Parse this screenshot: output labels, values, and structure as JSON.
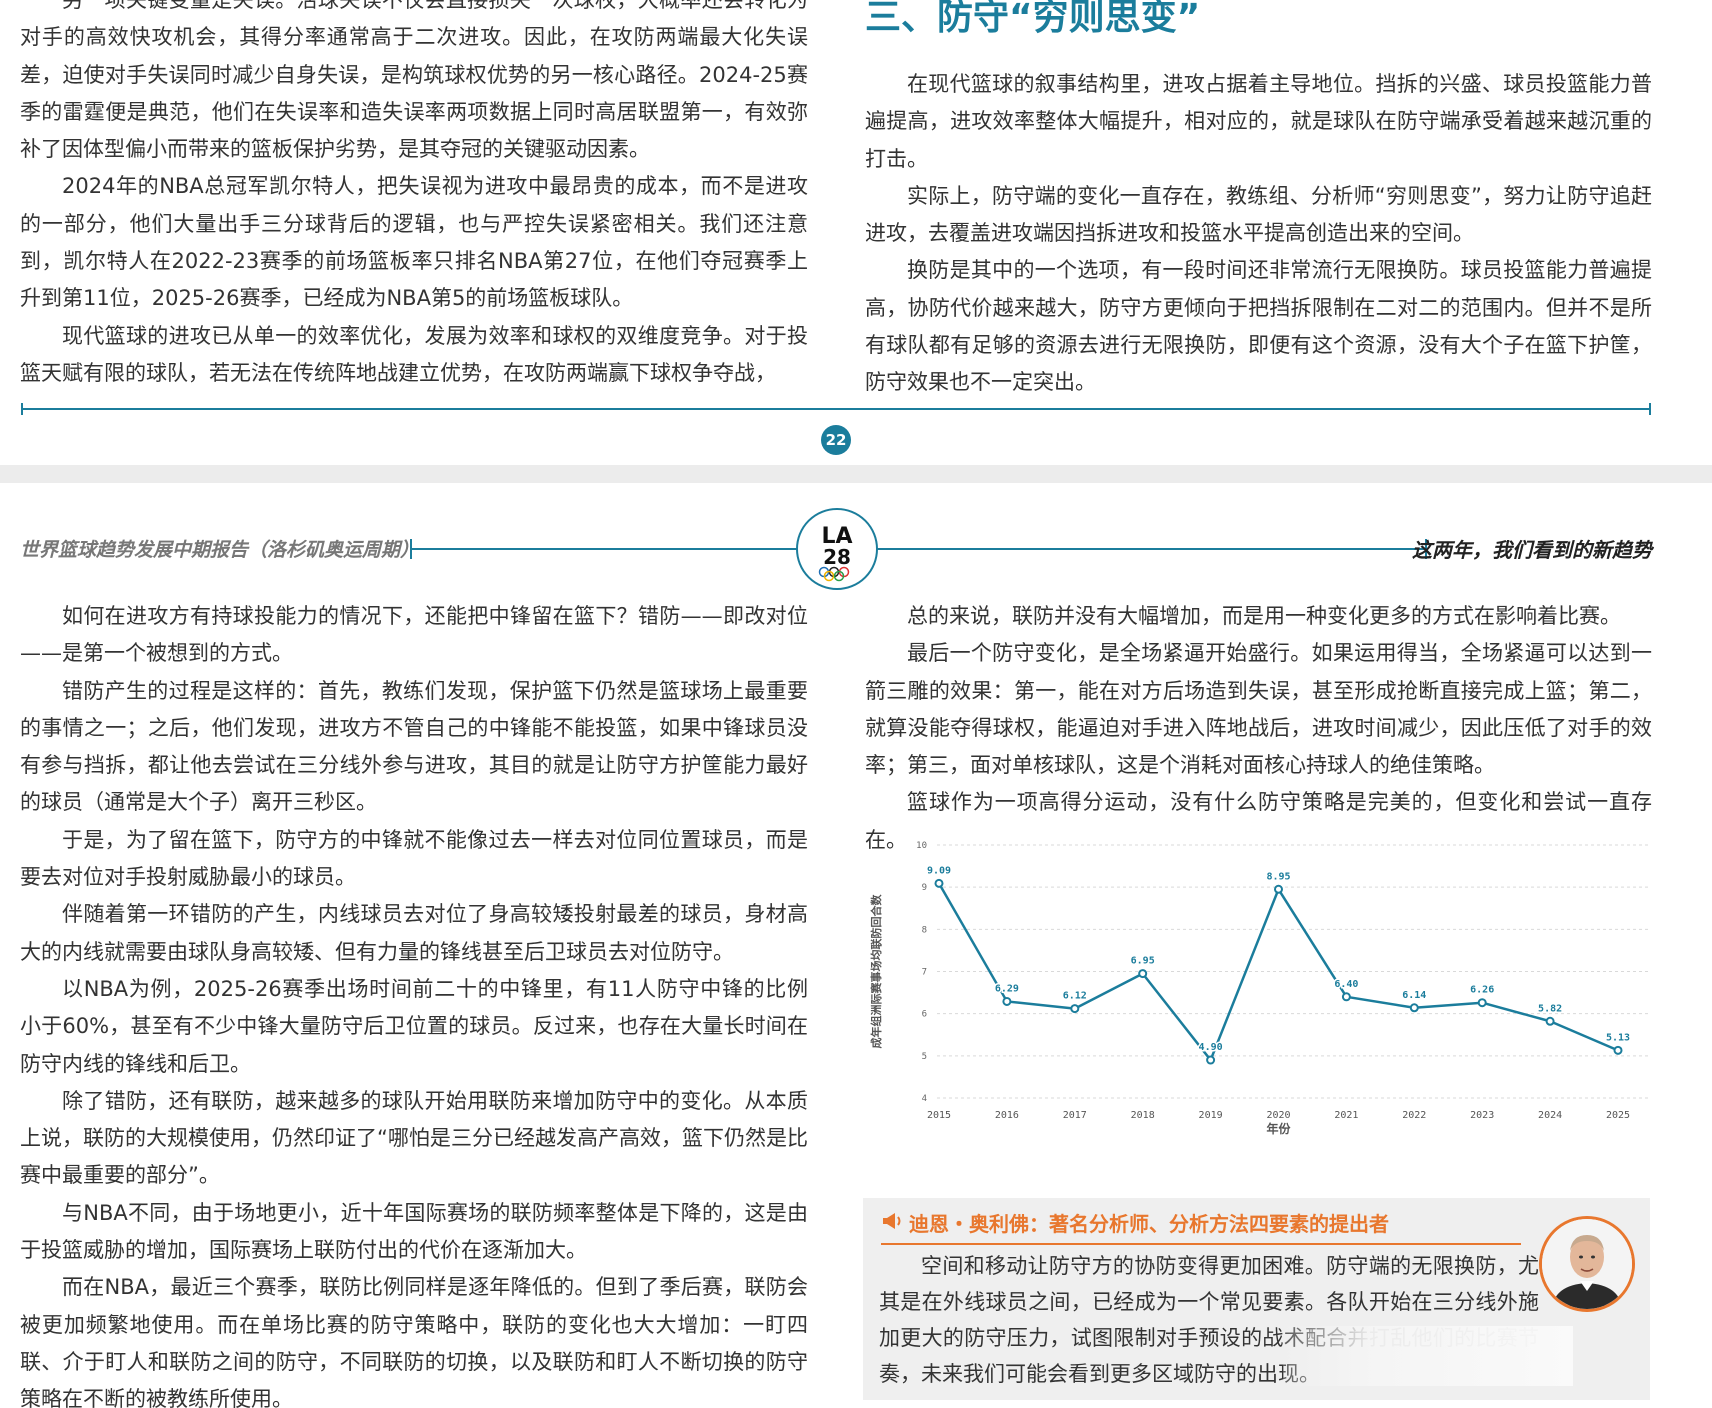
{
  "top_page": {
    "left_col": [
      "另一项关键变量是失误。活球失误不仅会直接损失一次球权，大概率还会转化为对手的高效快攻机会，其得分率通常高于二次进攻。因此，在攻防两端最大化失误差，迫使对手失误同时减少自身失误，是构筑球权优势的另一核心路径。2024-25赛季的雷霆便是典范，他们在失误率和造失误率两项数据上同时高居联盟第一，有效弥补了因体型偏小而带来的篮板保护劣势，是其夺冠的关键驱动因素。",
      "2024年的NBA总冠军凯尔特人，把失误视为进攻中最昂贵的成本，而不是进攻的一部分，他们大量出手三分球背后的逻辑，也与严控失误紧密相关。我们还注意到，凯尔特人在2022-23赛季的前场篮板率只排名NBA第27位，在他们夺冠赛季上升到第11位，2025-26赛季，已经成为NBA第5的前场篮板球队。",
      "现代篮球的进攻已从单一的效率优化，发展为效率和球权的双维度竞争。对于投篮天赋有限的球队，若无法在传统阵地战建立优势，在攻防两端赢下球权争夺战，"
    ],
    "section_title": "三、防守“穷则思变”",
    "right_col": [
      "在现代篮球的叙事结构里，进攻占据着主导地位。挡拆的兴盛、球员投篮能力普遍提高，进攻效率整体大幅提升，相对应的，就是球队在防守端承受着越来越沉重的打击。",
      "实际上，防守端的变化一直存在，教练组、分析师“穷则思变”，努力让防守追赶进攻，去覆盖进攻端因挡拆进攻和投篮水平提高创造出来的空间。",
      "换防是其中的一个选项，有一段时间还非常流行无限换防。球员投篮能力普遍提高，协防代价越来越大，防守方更倾向于把挡拆限制在二对二的范围内。但并不是所有球队都有足够的资源去进行无限换防，即便有这个资源，没有大个子在篮下护筐，防守效果也不一定突出。"
    ],
    "page_number": "22"
  },
  "header": {
    "left": "世界篮球趋势发展中期报告（洛杉矶奥运周期）",
    "right": "这两年，我们看到的新趋势",
    "logo_text_top": "LA",
    "logo_text_bottom": "28"
  },
  "bottom_page": {
    "left_col": [
      "如何在进攻方有持球投能力的情况下，还能把中锋留在篮下？错防——即改对位——是第一个被想到的方式。",
      "错防产生的过程是这样的：首先，教练们发现，保护篮下仍然是篮球场上最重要的事情之一；之后，他们发现，进攻方不管自己的中锋能不能投篮，如果中锋球员没有参与挡拆，都让他去尝试在三分线外参与进攻，其目的就是让防守方护筐能力最好的球员（通常是大个子）离开三秒区。",
      "于是，为了留在篮下，防守方的中锋就不能像过去一样去对位同位置球员，而是要去对位对手投射威胁最小的球员。",
      "伴随着第一环错防的产生，内线球员去对位了身高较矮投射最差的球员，身材高大的内线就需要由球队身高较矮、但有力量的锋线甚至后卫球员去对位防守。",
      "以NBA为例，2025-26赛季出场时间前二十的中锋里，有11人防守中锋的比例小于60%，甚至有不少中锋大量防守后卫位置的球员。反过来，也存在大量长时间在防守内线的锋线和后卫。",
      "除了错防，还有联防，越来越多的球队开始用联防来增加防守中的变化。从本质上说，联防的大规模使用，仍然印证了“哪怕是三分已经越发高产高效，篮下仍然是比赛中最重要的部分”。",
      "与NBA不同，由于场地更小，近十年国际赛场的联防频率整体是下降的，这是由于投篮威胁的增加，国际赛场上联防付出的代价在逐渐加大。",
      "而在NBA，最近三个赛季，联防比例同样是逐年降低的。但到了季后赛，联防会被更加频繁地使用。而在单场比赛的防守策略中，联防的变化也大大增加：一盯四联、介于盯人和联防之间的防守，不同联防的切换，以及联防和盯人不断切换的防守策略在不断的被教练所使用。"
    ],
    "right_col": [
      "总的来说，联防并没有大幅增加，而是用一种变化更多的方式在影响着比赛。",
      "最后一个防守变化，是全场紧逼开始盛行。如果运用得当，全场紧逼可以达到一箭三雕的效果：第一，能在对方后场造到失误，甚至形成抢断直接完成上篮；第二，就算没能夺得球权，能逼迫对手进入阵地战后，进攻时间减少，因此压低了对手的效率；第三，面对单核球队，这是个消耗对面核心持球人的绝佳策略。",
      "篮球作为一项高得分运动，没有什么防守策略是完美的，但变化和尝试一直存在。"
    ],
    "quote": {
      "title": "迪恩・奥利佛：著名分析师、分析方法四要素的提出者",
      "body": "空间和移动让防守方的协防变得更加困难。防守端的无限换防，尤其是在外线球员之间，已经成为一个常见要素。各队开始在三分线外施加更大的防守压力，试图限制对手预设的战术配合并打乱他们的比赛节奏，未来我们可能会看到更多区域防守的出现。"
    }
  },
  "chart_data": {
    "type": "line",
    "x": [
      "2015",
      "2016",
      "2017",
      "2018",
      "2019",
      "2020",
      "2021",
      "2022",
      "2023",
      "2024",
      "2025"
    ],
    "values": [
      9.09,
      6.29,
      6.12,
      6.95,
      4.9,
      8.95,
      6.4,
      6.14,
      6.26,
      5.82,
      5.13
    ],
    "labels": [
      "9.09",
      "6.29",
      "6.12",
      "6.95",
      "4.90",
      "8.95",
      "6.40",
      "6.14",
      "6.26",
      "5.82",
      "5.13"
    ],
    "xlabel": "年份",
    "ylabel": "成年组洲际赛事场均联防回合数",
    "ylim": [
      4,
      10
    ],
    "yticks": [
      "4",
      "5",
      "6",
      "7",
      "8",
      "9",
      "10"
    ],
    "grid": true,
    "color": "#1b7d9c"
  },
  "colors": {
    "accent": "#1b7d9c",
    "quote_accent": "#e8772e"
  }
}
